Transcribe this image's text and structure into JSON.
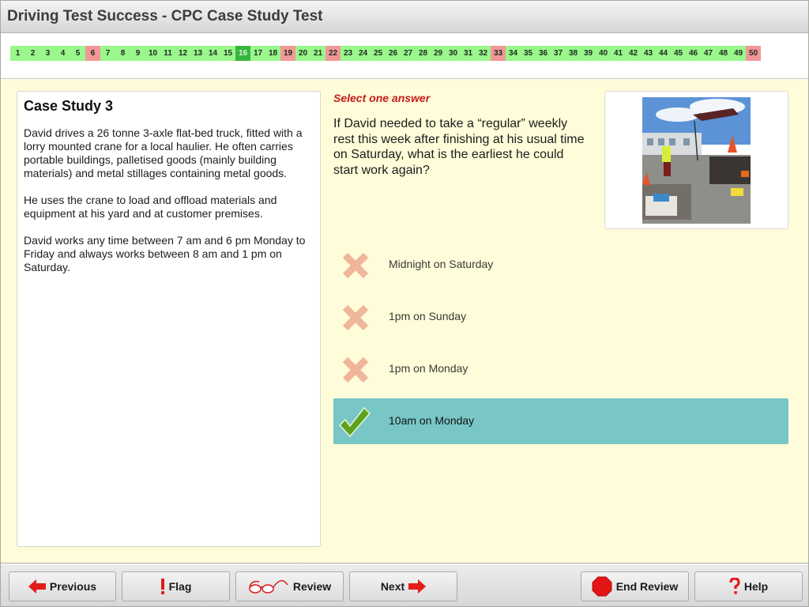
{
  "window": {
    "title": "Driving Test Success - CPC Case Study Test"
  },
  "question_nav": {
    "current": 16,
    "colors": {
      "correct": "#99f78c",
      "wrong": "#f29797",
      "current": "#39b53f"
    },
    "items": [
      {
        "n": "1",
        "status": "correct"
      },
      {
        "n": "2",
        "status": "correct"
      },
      {
        "n": "3",
        "status": "correct"
      },
      {
        "n": "4",
        "status": "correct"
      },
      {
        "n": "5",
        "status": "correct"
      },
      {
        "n": "6",
        "status": "wrong"
      },
      {
        "n": "7",
        "status": "correct"
      },
      {
        "n": "8",
        "status": "correct"
      },
      {
        "n": "9",
        "status": "correct"
      },
      {
        "n": "10",
        "status": "correct"
      },
      {
        "n": "11",
        "status": "correct"
      },
      {
        "n": "12",
        "status": "correct"
      },
      {
        "n": "13",
        "status": "correct"
      },
      {
        "n": "14",
        "status": "correct"
      },
      {
        "n": "15",
        "status": "correct"
      },
      {
        "n": "16",
        "status": "current"
      },
      {
        "n": "17",
        "status": "correct"
      },
      {
        "n": "18",
        "status": "correct"
      },
      {
        "n": "19",
        "status": "wrong"
      },
      {
        "n": "20",
        "status": "correct"
      },
      {
        "n": "21",
        "status": "correct"
      },
      {
        "n": "22",
        "status": "wrong"
      },
      {
        "n": "23",
        "status": "correct"
      },
      {
        "n": "24",
        "status": "correct"
      },
      {
        "n": "25",
        "status": "correct"
      },
      {
        "n": "26",
        "status": "correct"
      },
      {
        "n": "27",
        "status": "correct"
      },
      {
        "n": "28",
        "status": "correct"
      },
      {
        "n": "29",
        "status": "correct"
      },
      {
        "n": "30",
        "status": "correct"
      },
      {
        "n": "31",
        "status": "correct"
      },
      {
        "n": "32",
        "status": "correct"
      },
      {
        "n": "33",
        "status": "wrong"
      },
      {
        "n": "34",
        "status": "correct"
      },
      {
        "n": "35",
        "status": "correct"
      },
      {
        "n": "36",
        "status": "correct"
      },
      {
        "n": "37",
        "status": "correct"
      },
      {
        "n": "38",
        "status": "correct"
      },
      {
        "n": "39",
        "status": "correct"
      },
      {
        "n": "40",
        "status": "correct"
      },
      {
        "n": "41",
        "status": "correct"
      },
      {
        "n": "42",
        "status": "correct"
      },
      {
        "n": "43",
        "status": "correct"
      },
      {
        "n": "44",
        "status": "correct"
      },
      {
        "n": "45",
        "status": "correct"
      },
      {
        "n": "46",
        "status": "correct"
      },
      {
        "n": "47",
        "status": "correct"
      },
      {
        "n": "48",
        "status": "correct"
      },
      {
        "n": "49",
        "status": "correct"
      },
      {
        "n": "50",
        "status": "wrong"
      }
    ]
  },
  "case_study": {
    "title": "Case Study 3",
    "paragraphs": [
      "David drives a 26 tonne 3-axle flat-bed truck, fitted with a lorry mounted crane for a local haulier. He often carries portable buildings, palletised goods (mainly building materials) and metal stillages containing metal goods.",
      "He uses the crane to load and offload materials and equipment at his yard and at customer premises.",
      "David works any time between 7 am and 6 pm Monday to Friday and always works between 8 am and 1 pm on Saturday."
    ]
  },
  "question": {
    "instruction": "Select one answer",
    "text": "If David needed to take a “regular” weekly rest this week after finishing at his usual time on Saturday, what is the earliest he could start work again?",
    "image_alt": "Truck with lorry mounted crane in a yard",
    "answers": [
      {
        "label": "Midnight on Saturday",
        "mark": "cross-icon",
        "selected": false
      },
      {
        "label": "1pm on Sunday",
        "mark": "cross-icon",
        "selected": false
      },
      {
        "label": "1pm on Monday",
        "mark": "cross-icon",
        "selected": false
      },
      {
        "label": "10am on Monday",
        "mark": "check-icon",
        "selected": true
      }
    ],
    "selected_color": "#78c6c6"
  },
  "footer": {
    "previous": "Previous",
    "flag": "Flag",
    "review": "Review",
    "next": "Next",
    "end_review": "End Review",
    "help": "Help"
  }
}
